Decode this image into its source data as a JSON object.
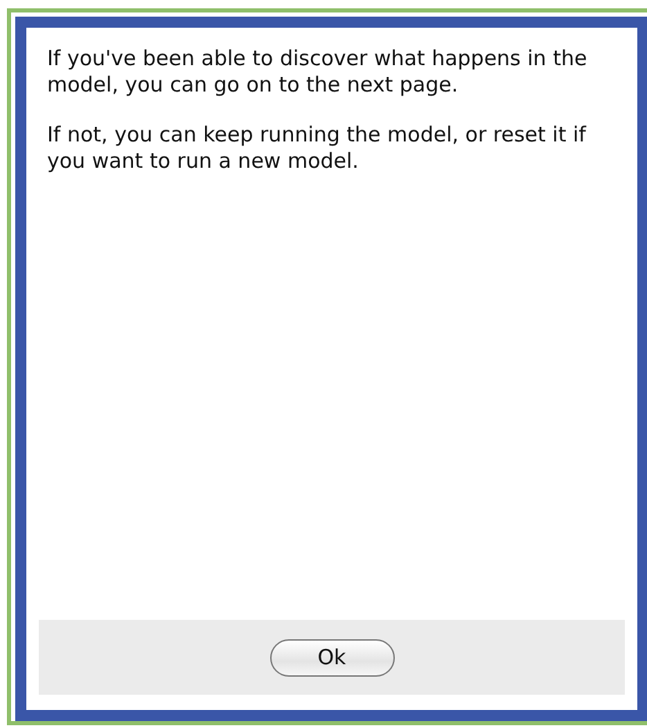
{
  "dialog": {
    "paragraphs": [
      "If you've been able to discover what happens in the model, you can go on to the next page.",
      "If not, you can keep running the model, or reset it if you want to run a new model."
    ],
    "buttons": [
      "Ok"
    ]
  }
}
